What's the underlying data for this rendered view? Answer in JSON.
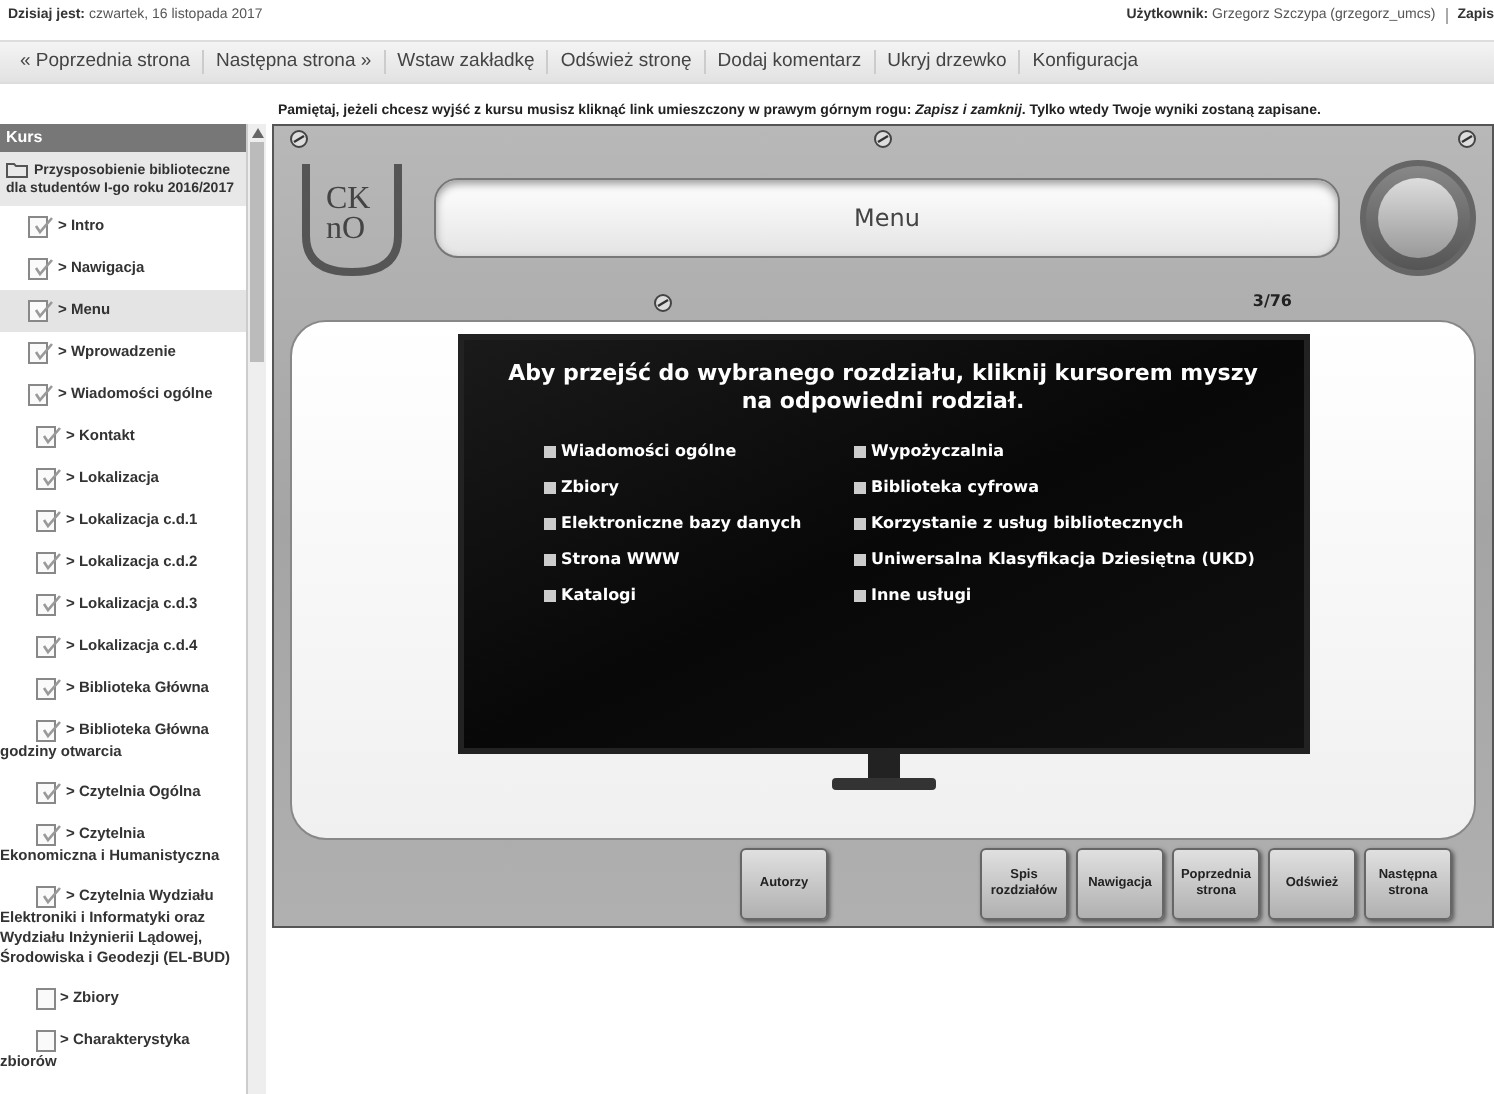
{
  "top_bar": {
    "date_label": "Dzisiaj jest:",
    "date": "czwartek, 16 listopada 2017",
    "user_label": "Użytkownik:",
    "user": "Grzegorz Szczypa (grzegorz_umcs)",
    "save_link": "Zapis"
  },
  "toolbar": [
    "« Poprzednia strona",
    "Następna strona »",
    "Wstaw zakładkę",
    "Odśwież stronę",
    "Dodaj komentarz",
    "Ukryj drzewko",
    "Konfiguracja"
  ],
  "notice": "Pamiętaj, jeżeli chcesz wyjść z kursu musisz kliknąć link umieszczony w prawym górnym rogu: *Zapisz i zamknij*. Tylko wtedy Twoje wyniki zostaną zapisane.",
  "sidebar": {
    "title": "Kurs",
    "root": {
      "label": "Przysposobienie biblioteczne dla studentów I-go roku 2016/2017",
      "children": [
        {
          "label": "> Intro",
          "kind": "checked",
          "selected": false
        },
        {
          "label": "> Nawigacja",
          "kind": "checked",
          "selected": false
        },
        {
          "label": "> Menu",
          "kind": "checked",
          "selected": true
        },
        {
          "label": "> Wprowadzenie",
          "kind": "checked",
          "selected": false
        },
        {
          "label": "> Wiadomości ogólne",
          "kind": "checked",
          "selected": false,
          "children": [
            {
              "label": "> Kontakt",
              "kind": "checked",
              "selected": false
            },
            {
              "label": "> Lokalizacja",
              "kind": "checked",
              "selected": false
            },
            {
              "label": "> Lokalizacja c.d.1",
              "kind": "checked",
              "selected": false
            },
            {
              "label": "> Lokalizacja c.d.2",
              "kind": "checked",
              "selected": false
            },
            {
              "label": "> Lokalizacja c.d.3",
              "kind": "checked",
              "selected": false
            },
            {
              "label": "> Lokalizacja c.d.4",
              "kind": "checked",
              "selected": false
            },
            {
              "label": "> Biblioteka Główna",
              "kind": "checked",
              "selected": false
            },
            {
              "label": "> Biblioteka Główna godziny otwarcia",
              "kind": "checked",
              "selected": false
            },
            {
              "label": "> Czytelnia Ogólna",
              "kind": "checked",
              "selected": false
            },
            {
              "label": "> Czytelnia Ekonomiczna i Humanistyczna",
              "kind": "checked",
              "selected": false
            },
            {
              "label": "> Czytelnia Wydziału Elektroniki i Informatyki oraz Wydziału Inżynierii Lądowej, Środowiska i Geodezji (EL-BUD)",
              "kind": "checked",
              "selected": false
            },
            {
              "label": "> Zbiory",
              "kind": "blank",
              "selected": false
            },
            {
              "label": "> Charakterystyka zbiorów",
              "kind": "blank",
              "selected": false
            }
          ]
        }
      ]
    }
  },
  "lesson": {
    "logo": [
      "CK",
      "nO"
    ],
    "title": "Menu",
    "page": "3/76",
    "heading": "Aby przejść do wybranego rozdziału, kliknij kursorem myszy na odpowiedni rodział.",
    "chapters_left": [
      "Wiadomości ogólne",
      "Zbiory",
      "Elektroniczne bazy danych",
      "Strona WWW",
      "Katalogi"
    ],
    "chapters_right": [
      "Wypożyczalnia",
      "Biblioteka cyfrowa",
      "Korzystanie z usług bibliotecznych",
      "Uniwersalna Klasyfikacja Dziesiętna (UKD)",
      "Inne usługi"
    ],
    "authors_button": "Autorzy",
    "nav_buttons": [
      "Spis rozdziałów",
      "Nawigacja",
      "Poprzednia strona",
      "Odśwież",
      "Następna strona"
    ]
  }
}
